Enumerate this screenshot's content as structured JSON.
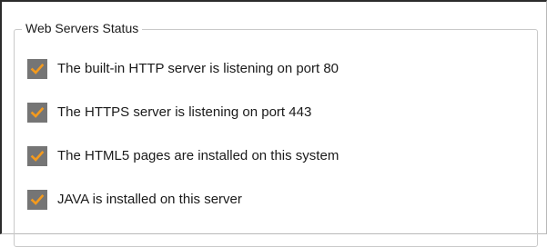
{
  "group": {
    "title": "Web Servers Status"
  },
  "status_items": [
    {
      "label": "The built-in HTTP server is listening on port 80",
      "checked": true,
      "icon": "check-icon"
    },
    {
      "label": "The HTTPS server is listening on port 443",
      "checked": true,
      "icon": "check-icon"
    },
    {
      "label": "The HTML5 pages are installed on this system",
      "checked": true,
      "icon": "check-icon"
    },
    {
      "label": "JAVA is installed on this server",
      "checked": true,
      "icon": "check-icon"
    }
  ],
  "colors": {
    "check_mark": "#f39a1e",
    "check_background": "#757575",
    "group_border": "#c9c9c9"
  }
}
